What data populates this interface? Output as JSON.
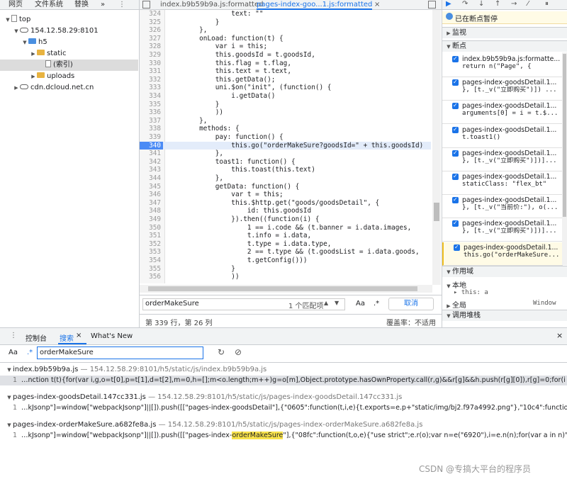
{
  "navigator": {
    "tabs": [
      "网页",
      "文件系统",
      "替换"
    ],
    "more": "»",
    "tree": [
      {
        "label": "top",
        "indent": 0,
        "icon": "file-icon",
        "expanded": true
      },
      {
        "label": "154.12.58.29:8101",
        "indent": 1,
        "icon": "cloud-icon",
        "expanded": true
      },
      {
        "label": "h5",
        "indent": 2,
        "icon": "folder-icon",
        "expanded": true,
        "blue": true
      },
      {
        "label": "static",
        "indent": 3,
        "icon": "folder-icon",
        "expanded": false
      },
      {
        "label": "(索引)",
        "indent": 4,
        "icon": "file-icon",
        "selected": true
      },
      {
        "label": "uploads",
        "indent": 3,
        "icon": "folder-icon",
        "expanded": false
      },
      {
        "label": "cdn.dcloud.net.cn",
        "indent": 1,
        "icon": "cloud-icon",
        "expanded": false
      }
    ]
  },
  "editor": {
    "tabs": [
      {
        "label": "index.b9b59b9a.js:formatted",
        "active": false
      },
      {
        "label": "pages-index-goo...1.js:formatted",
        "active": true
      }
    ],
    "close_label": "×",
    "lines": [
      {
        "n": "324",
        "code": "                text: \"\""
      },
      {
        "n": "325",
        "code": "            }"
      },
      {
        "n": "326",
        "code": "        },"
      },
      {
        "n": "327",
        "code": "        onLoad: function(t) {"
      },
      {
        "n": "328",
        "code": "            var i = this;"
      },
      {
        "n": "329",
        "code": "            this.goodsId = t.goodsId,"
      },
      {
        "n": "330",
        "code": "            this.flag = t.flag,"
      },
      {
        "n": "331",
        "code": "            this.text = t.text,"
      },
      {
        "n": "332",
        "code": "            this.getData();"
      },
      {
        "n": "333",
        "code": "            uni.$on(\"init\", (function() {"
      },
      {
        "n": "334",
        "code": "                i.getData()"
      },
      {
        "n": "335",
        "code": "            }"
      },
      {
        "n": "336",
        "code": "            ))"
      },
      {
        "n": "337",
        "code": "        },"
      },
      {
        "n": "338",
        "code": "        methods: {"
      },
      {
        "n": "339",
        "code": "            pay: function() {"
      },
      {
        "n": "340",
        "code": "                this.go(\"orderMakeSure?goodsId=\" + this.goodsId)",
        "bp": true
      },
      {
        "n": "341",
        "code": "            },"
      },
      {
        "n": "342",
        "code": "            toast1: function() {"
      },
      {
        "n": "343",
        "code": "                this.toast(this.text)"
      },
      {
        "n": "344",
        "code": "            },"
      },
      {
        "n": "345",
        "code": "            getData: function() {"
      },
      {
        "n": "346",
        "code": "                var t = this;"
      },
      {
        "n": "347",
        "code": "                this.$http.get(\"goods/goodsDetail\", {"
      },
      {
        "n": "348",
        "code": "                    id: this.goodsId"
      },
      {
        "n": "349",
        "code": "                }).then((function(i) {"
      },
      {
        "n": "350",
        "code": "                    1 == i.code && (t.banner = i.data.images,"
      },
      {
        "n": "351",
        "code": "                    t.info = i.data,"
      },
      {
        "n": "352",
        "code": "                    t.type = i.data.type,"
      },
      {
        "n": "353",
        "code": "                    2 == t.type && (t.goodsList = i.data.goods,"
      },
      {
        "n": "354",
        "code": "                    t.getConfig()))"
      },
      {
        "n": "355",
        "code": "                }"
      },
      {
        "n": "356",
        "code": "                ))"
      }
    ],
    "find": {
      "value": "orderMakeSure",
      "count": "1 个匹配项",
      "up": "▲",
      "down": "▼",
      "case": "Aa",
      "regex": ".*",
      "cancel": "取消"
    },
    "status": {
      "position": "第 339 行，第 26 列",
      "coverage": "覆盖率：不适用"
    }
  },
  "debugger": {
    "paused_label": "已在断点暂停",
    "sections": {
      "watch": "监视",
      "breakpoints": "断点",
      "scope": "作用域",
      "callstack": "调用堆栈"
    },
    "breakpoints": [
      {
        "file": "index.b9b59b9a.js:formatte...",
        "code": "return n(\"Page\", {"
      },
      {
        "file": "pages-index-goodsDetail.1...",
        "code": "}, [t._v(\"立即购买\")]) ..."
      },
      {
        "file": "pages-index-goodsDetail.1...",
        "code": "arguments[0] = i = t.$..."
      },
      {
        "file": "pages-index-goodsDetail.1...",
        "code": "t.toast1()"
      },
      {
        "file": "pages-index-goodsDetail.1...",
        "code": "}, [t._v(\"立即购买\")])]..."
      },
      {
        "file": "pages-index-goodsDetail.1...",
        "code": "staticClass: \"flex_bt\""
      },
      {
        "file": "pages-index-goodsDetail.1...",
        "code": "}, [t._v(\"当前价:\"), o(..."
      },
      {
        "file": "pages-index-goodsDetail.1...",
        "code": "}, [t._v(\"立即购买\")])]..."
      },
      {
        "file": "pages-index-goodsDetail.1...",
        "code": "this.go(\"orderMakeSure...",
        "active": true
      }
    ],
    "scope": {
      "local": "本地",
      "this_label": "▸ this: a",
      "global": "全局",
      "window": "Window"
    }
  },
  "drawer": {
    "tabs": [
      {
        "label": "控制台",
        "active": false
      },
      {
        "label": "搜索",
        "active": true
      },
      {
        "label": "What's New",
        "active": false
      }
    ],
    "search": {
      "case": "Aa",
      "regex": ".*",
      "value": "orderMakeSure",
      "refresh": "↻",
      "clear": "⊘"
    },
    "results": [
      {
        "file": "index.b9b59b9a.js",
        "path": "154.12.58.29:8101/h5/static/js/index.b9b59b9a.js",
        "line_no": "1",
        "pre": "…nction t(t){for(var i,g,o=t[0],p=t[1],d=t[2],m=0,h=[];m<o.length;m++)g=o[m],Object.prototype.hasOwnProperty.call(r,g)&&r[g]&&h.push(r[g][0]),r[g]=0;for(i in p)Object.proto…",
        "match": "",
        "post": "",
        "selected": true
      },
      {
        "file": "pages-index-goodsDetail.147cc331.js",
        "path": "154.12.58.29:8101/h5/static/js/pages-index-goodsDetail.147cc331.js",
        "line_no": "1",
        "pre": "…kJsonp\"]=window[\"webpackJsonp\"]||[]).push([[\"pages-index-goodsDetail\"],{\"0605\":function(t,i,e){t.exports=e.p+\"static/img/bj2.f97a4992.png\"},\"10c4\":function(t,i,e){\"use strict…",
        "match": "",
        "post": "",
        "selected": false
      },
      {
        "file": "pages-index-orderMakeSure.a682fe8a.js",
        "path": "154.12.58.29:8101/h5/static/js/pages-index-orderMakeSure.a682fe8a.js",
        "line_no": "1",
        "pre": "…kJsonp\"]=window[\"webpackJsonp\"]||[]).push([[\"pages-index-",
        "match": "orderMakeSure",
        "post": "\"],{\"08fc\":function(t,o,e){\"use strict\";e.r(o);var n=e(\"6920\"),i=e.n(n);for(var a in n)\"default\"!==a&&f…",
        "selected": false
      }
    ]
  },
  "watermark": "CSDN @专搞大平台的程序员"
}
